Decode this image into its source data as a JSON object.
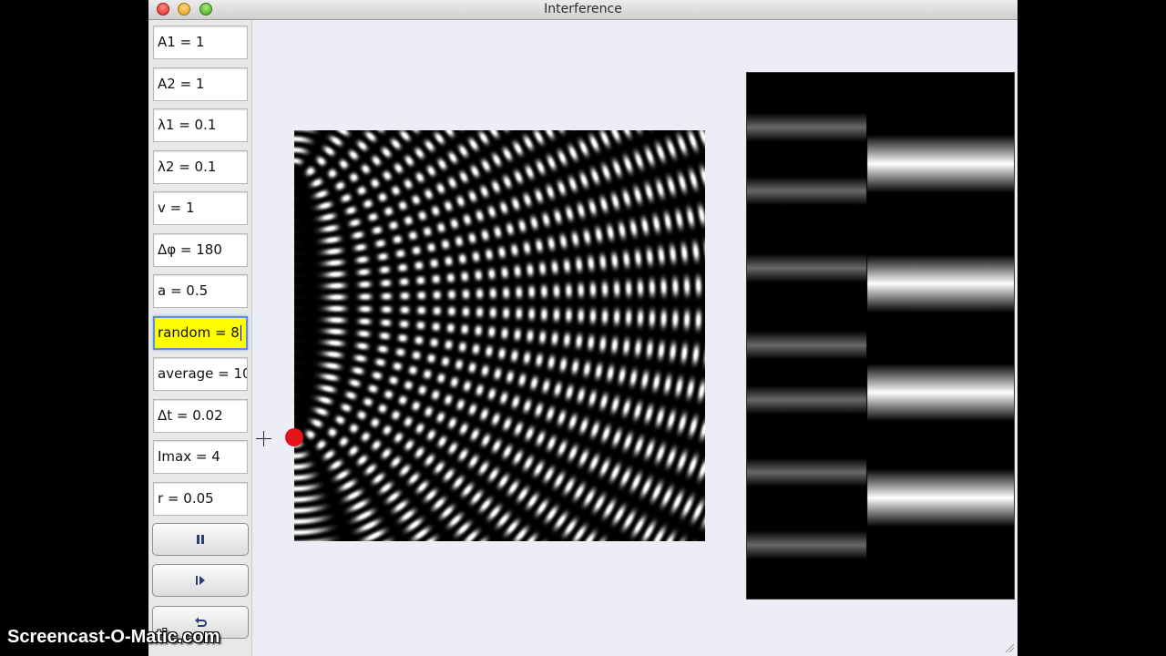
{
  "window": {
    "title": "Interference"
  },
  "parameters": [
    {
      "label": "A1 = 1",
      "name": "param-a1"
    },
    {
      "label": "A2 = 1",
      "name": "param-a2"
    },
    {
      "label": "λ1 = 0.1",
      "name": "param-lambda1"
    },
    {
      "label": "λ2 = 0.1",
      "name": "param-lambda2"
    },
    {
      "label": "v = 1",
      "name": "param-v"
    },
    {
      "label": "Δφ = 180",
      "name": "param-delta-phi"
    },
    {
      "label": "a = 0.5",
      "name": "param-a"
    },
    {
      "label": "random = 8",
      "name": "param-random",
      "active": true
    },
    {
      "label": "average = 10",
      "name": "param-average"
    },
    {
      "label": "Δt = 0.02",
      "name": "param-delta-t"
    },
    {
      "label": "Imax = 4",
      "name": "param-imax"
    },
    {
      "label": "r = 0.05",
      "name": "param-r"
    }
  ],
  "controls": [
    {
      "icon": "pause-icon"
    },
    {
      "icon": "step-forward-icon"
    },
    {
      "icon": "reset-icon"
    }
  ],
  "colors": {
    "active_field": "#ffff00",
    "source_dot": "#e0141a",
    "window_background": "#ededf7"
  },
  "watermark": "Screencast-O-Matic.com"
}
